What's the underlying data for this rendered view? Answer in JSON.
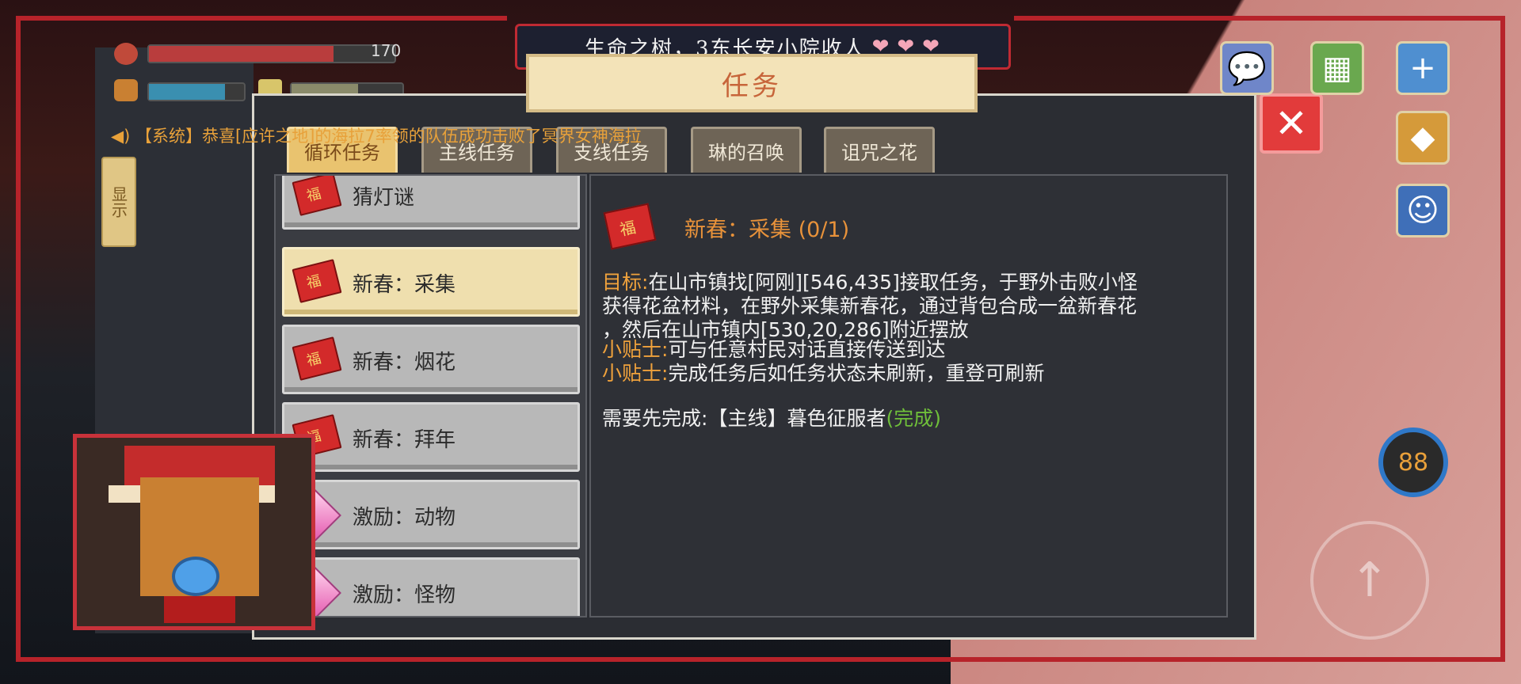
{
  "title_bar": {
    "text": "生命之树，3东长安小院收人",
    "hearts": [
      "❤",
      "❤",
      "❤"
    ]
  },
  "status": {
    "hp_value": "170"
  },
  "announcement": {
    "icon": "speaker-icon",
    "text": "【系统】恭喜[应许之地]的海拉7率领的队伍成功击败了冥界女神海拉"
  },
  "side_toggle": {
    "label": "显示"
  },
  "panel": {
    "title": "任务",
    "tabs": [
      {
        "label": "循环任务",
        "active": true
      },
      {
        "label": "主线任务",
        "active": false
      },
      {
        "label": "支线任务",
        "active": false
      },
      {
        "label": "琳的召唤",
        "active": false
      },
      {
        "label": "诅咒之花",
        "active": false
      }
    ],
    "list": [
      {
        "label": "猜灯谜",
        "icon": "red-envelope-icon"
      },
      {
        "label": "新春：采集",
        "icon": "red-envelope-icon",
        "selected": true
      },
      {
        "label": "新春：烟花",
        "icon": "red-envelope-icon"
      },
      {
        "label": "新春：拜年",
        "icon": "red-envelope-icon"
      },
      {
        "label": "激励：动物",
        "icon": "gem-icon"
      },
      {
        "label": "激励：怪物",
        "icon": "gem-icon"
      }
    ],
    "detail": {
      "title": "新春：采集 (0/1)",
      "goal_label": "目标:",
      "goal_line1": "在山市镇找[阿刚][546,435]接取任务，于野外击败小怪",
      "goal_line2": "获得花盆材料，在野外采集新春花，通过背包合成一盆新春花",
      "goal_line3": "，然后在山市镇内[530,20,286]附近摆放",
      "tip_label": "小贴士:",
      "tip1": "可与任意村民对话直接传送到达",
      "tip2": "完成任务后如任务状态未刷新，重登可刷新",
      "prereq_label": "需要先完成:",
      "prereq_value": "【主线】暮色征服者",
      "prereq_status": "(完成)"
    }
  },
  "close_button": {
    "icon": "close-icon"
  },
  "right_icons": [
    "chat-icon",
    "shop-icon",
    "plus-icon",
    "blocks-icon",
    "badge-icon"
  ],
  "level": {
    "value": "88"
  },
  "colors": {
    "accent_red": "#c02a33",
    "task_orange": "#f0a23c",
    "done_green": "#6fbf3a",
    "selected_item": "#efdfae"
  }
}
